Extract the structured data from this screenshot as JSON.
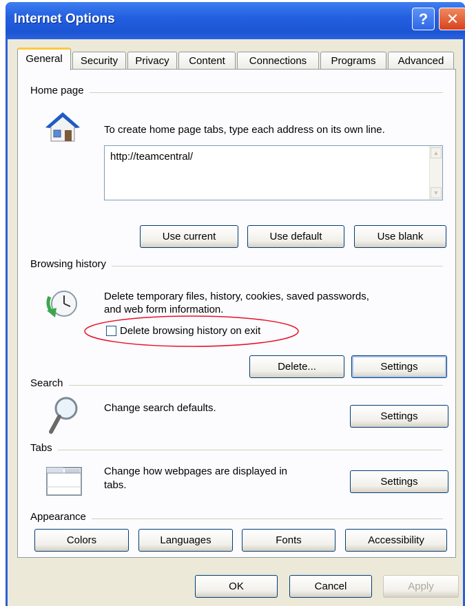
{
  "window": {
    "title": "Internet Options",
    "help_glyph": "?",
    "close_glyph": "✕"
  },
  "tabs": [
    {
      "label": "General",
      "active": true
    },
    {
      "label": "Security"
    },
    {
      "label": "Privacy"
    },
    {
      "label": "Content"
    },
    {
      "label": "Connections"
    },
    {
      "label": "Programs"
    },
    {
      "label": "Advanced"
    }
  ],
  "home_page": {
    "group_label": "Home page",
    "description": "To create home page tabs, type each address on its own line.",
    "url_value": "http://teamcentral/",
    "buttons": {
      "use_current": "Use current",
      "use_default": "Use default",
      "use_blank": "Use blank"
    }
  },
  "browsing_history": {
    "group_label": "Browsing history",
    "description_line1": "Delete temporary files, history, cookies, saved passwords,",
    "description_line2": "and web form information.",
    "checkbox_label": "Delete browsing history on exit",
    "checkbox_checked": false,
    "buttons": {
      "delete": "Delete...",
      "settings": "Settings"
    }
  },
  "search": {
    "group_label": "Search",
    "description": "Change search defaults.",
    "settings_label": "Settings"
  },
  "tabs_group": {
    "group_label": "Tabs",
    "description_line1": "Change how webpages are displayed in",
    "description_line2": "tabs.",
    "settings_label": "Settings"
  },
  "appearance": {
    "group_label": "Appearance",
    "buttons": {
      "colors": "Colors",
      "languages": "Languages",
      "fonts": "Fonts",
      "accessibility": "Accessibility"
    }
  },
  "footer": {
    "ok": "OK",
    "cancel": "Cancel",
    "apply": "Apply"
  },
  "annotation": {
    "highlight_color": "#e8102a"
  }
}
